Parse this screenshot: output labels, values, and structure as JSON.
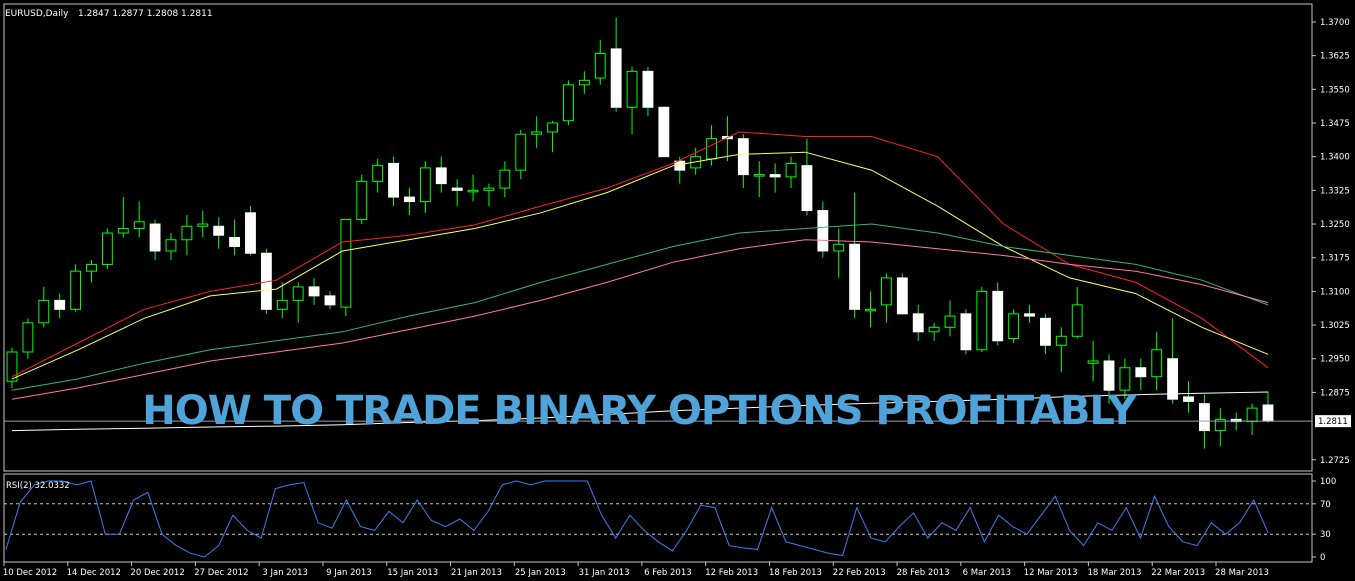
{
  "header": {
    "symbol": "EURUSD,Daily",
    "ohlc": "1.2847 1.2877 1.2808 1.2811"
  },
  "overlay_title": "HOW TO TRADE BINARY OPTIONS PROFITABLY",
  "colors": {
    "background": "#000000",
    "bull_candle": "#000000",
    "bear_candle": "#ffffff",
    "wick": "#00ff00",
    "ma_red": "#ff2020",
    "ma_yellow": "#ffff66",
    "ma_green": "#3cb371",
    "ma_pink": "#ff7a9c",
    "ma_white": "#ffffff",
    "rsi_line": "#3a7ff0",
    "title_blue": "#4fa3d9"
  },
  "chart_data": [
    {
      "type": "candlestick",
      "title": "EURUSD,Daily",
      "ylim": [
        1.27,
        1.374
      ],
      "y_ticks": [
        "1.3700",
        "1.3625",
        "1.3550",
        "1.3475",
        "1.3400",
        "1.3325",
        "1.3250",
        "1.3175",
        "1.3100",
        "1.3025",
        "1.2950",
        "1.2875",
        "1.2725"
      ],
      "current_price": "1.2811",
      "x_tick_labels": [
        "10 Dec 2012",
        "14 Dec 2012",
        "20 Dec 2012",
        "27 Dec 2012",
        "3 Jan 2013",
        "9 Jan 2013",
        "15 Jan 2013",
        "21 Jan 2013",
        "25 Jan 2013",
        "31 Jan 2013",
        "6 Feb 2013",
        "12 Feb 2013",
        "18 Feb 2013",
        "22 Feb 2013",
        "28 Feb 2013",
        "6 Mar 2013",
        "12 Mar 2013",
        "18 Mar 2013",
        "22 Mar 2013",
        "28 Mar 2013"
      ],
      "ohlc": [
        [
          1.29,
          1.2975,
          1.2885,
          1.2965
        ],
        [
          1.2965,
          1.304,
          1.295,
          1.303
        ],
        [
          1.303,
          1.311,
          1.302,
          1.308
        ],
        [
          1.308,
          1.3095,
          1.304,
          1.306
        ],
        [
          1.306,
          1.316,
          1.3055,
          1.3145
        ],
        [
          1.3145,
          1.317,
          1.312,
          1.316
        ],
        [
          1.316,
          1.324,
          1.315,
          1.323
        ],
        [
          1.323,
          1.331,
          1.322,
          1.324
        ],
        [
          1.324,
          1.33,
          1.322,
          1.3255
        ],
        [
          1.325,
          1.326,
          1.317,
          1.319
        ],
        [
          1.319,
          1.323,
          1.317,
          1.3215
        ],
        [
          1.3215,
          1.327,
          1.318,
          1.3245
        ],
        [
          1.3245,
          1.328,
          1.322,
          1.325
        ],
        [
          1.3245,
          1.3265,
          1.3195,
          1.3225
        ],
        [
          1.322,
          1.326,
          1.318,
          1.32
        ],
        [
          1.3275,
          1.329,
          1.318,
          1.3185
        ],
        [
          1.3185,
          1.3195,
          1.305,
          1.306
        ],
        [
          1.306,
          1.312,
          1.304,
          1.308
        ],
        [
          1.308,
          1.312,
          1.303,
          1.311
        ],
        [
          1.311,
          1.313,
          1.307,
          1.309
        ],
        [
          1.309,
          1.31,
          1.306,
          1.307
        ],
        [
          1.3065,
          1.325,
          1.3045,
          1.326
        ],
        [
          1.326,
          1.336,
          1.325,
          1.3345
        ],
        [
          1.3345,
          1.3395,
          1.332,
          1.338
        ],
        [
          1.3385,
          1.34,
          1.329,
          1.331
        ],
        [
          1.331,
          1.333,
          1.327,
          1.33
        ],
        [
          1.33,
          1.339,
          1.3275,
          1.3375
        ],
        [
          1.3375,
          1.34,
          1.332,
          1.334
        ],
        [
          1.333,
          1.335,
          1.329,
          1.3325
        ],
        [
          1.3325,
          1.336,
          1.33,
          1.3325
        ],
        [
          1.3325,
          1.334,
          1.329,
          1.333
        ],
        [
          1.333,
          1.339,
          1.331,
          1.337
        ],
        [
          1.337,
          1.346,
          1.335,
          1.345
        ],
        [
          1.345,
          1.349,
          1.342,
          1.3455
        ],
        [
          1.3455,
          1.348,
          1.341,
          1.3475
        ],
        [
          1.348,
          1.357,
          1.347,
          1.356
        ],
        [
          1.356,
          1.359,
          1.354,
          1.357
        ],
        [
          1.3575,
          1.366,
          1.356,
          1.363
        ],
        [
          1.364,
          1.371,
          1.35,
          1.351
        ],
        [
          1.351,
          1.36,
          1.345,
          1.359
        ],
        [
          1.359,
          1.36,
          1.349,
          1.351
        ],
        [
          1.351,
          1.351,
          1.34,
          1.34
        ],
        [
          1.339,
          1.34,
          1.334,
          1.337
        ],
        [
          1.3375,
          1.342,
          1.336,
          1.34
        ],
        [
          1.3395,
          1.347,
          1.338,
          1.344
        ],
        [
          1.3445,
          1.349,
          1.339,
          1.344
        ],
        [
          1.344,
          1.345,
          1.333,
          1.336
        ],
        [
          1.336,
          1.339,
          1.331,
          1.336
        ],
        [
          1.336,
          1.3385,
          1.332,
          1.3355
        ],
        [
          1.3355,
          1.34,
          1.333,
          1.3385
        ],
        [
          1.338,
          1.344,
          1.327,
          1.328
        ],
        [
          1.328,
          1.33,
          1.3175,
          1.319
        ],
        [
          1.319,
          1.324,
          1.313,
          1.3205
        ],
        [
          1.3205,
          1.332,
          1.304,
          1.306
        ],
        [
          1.306,
          1.31,
          1.302,
          1.306
        ],
        [
          1.307,
          1.314,
          1.303,
          1.313
        ],
        [
          1.313,
          1.314,
          1.305,
          1.305
        ],
        [
          1.305,
          1.307,
          1.299,
          1.301
        ],
        [
          1.301,
          1.303,
          1.299,
          1.302
        ],
        [
          1.302,
          1.308,
          1.3,
          1.3045
        ],
        [
          1.305,
          1.306,
          1.296,
          1.297
        ],
        [
          1.297,
          1.311,
          1.2965,
          1.31
        ],
        [
          1.31,
          1.312,
          1.298,
          1.299
        ],
        [
          1.2995,
          1.306,
          1.2985,
          1.305
        ],
        [
          1.305,
          1.307,
          1.303,
          1.3045
        ],
        [
          1.304,
          1.305,
          1.296,
          1.298
        ],
        [
          1.298,
          1.302,
          1.292,
          1.3
        ],
        [
          1.3,
          1.311,
          1.2995,
          1.307
        ],
        [
          1.294,
          1.299,
          1.29,
          1.2945
        ],
        [
          1.2945,
          1.296,
          1.285,
          1.288
        ],
        [
          1.288,
          1.295,
          1.286,
          1.293
        ],
        [
          1.293,
          1.295,
          1.288,
          1.291
        ],
        [
          1.291,
          1.301,
          1.288,
          1.297
        ],
        [
          1.295,
          1.304,
          1.285,
          1.286
        ],
        [
          1.2865,
          1.29,
          1.283,
          1.2855
        ],
        [
          1.285,
          1.287,
          1.275,
          1.279
        ],
        [
          1.279,
          1.284,
          1.2755,
          1.2815
        ],
        [
          1.2815,
          1.283,
          1.279,
          1.281
        ],
        [
          1.281,
          1.285,
          1.278,
          1.284
        ],
        [
          1.2847,
          1.2877,
          1.2808,
          1.2811
        ]
      ],
      "moving_averages": [
        {
          "color_key": "ma_red",
          "values": [
            1.291,
            1.2985,
            1.306,
            1.31,
            1.3125,
            1.321,
            1.3225,
            1.3248,
            1.329,
            1.333,
            1.3385,
            1.3455,
            1.3445,
            1.3445,
            1.34,
            1.325,
            1.316,
            1.312,
            1.304,
            1.293
          ]
        },
        {
          "color_key": "ma_yellow",
          "values": [
            1.2905,
            1.297,
            1.304,
            1.309,
            1.3105,
            1.319,
            1.3215,
            1.324,
            1.3275,
            1.332,
            1.338,
            1.3405,
            1.341,
            1.337,
            1.329,
            1.32,
            1.313,
            1.3095,
            1.302,
            1.296
          ]
        },
        {
          "color_key": "ma_green",
          "values": [
            1.288,
            1.2905,
            1.294,
            1.297,
            1.299,
            1.301,
            1.3045,
            1.3075,
            1.312,
            1.316,
            1.32,
            1.323,
            1.324,
            1.325,
            1.323,
            1.32,
            1.318,
            1.316,
            1.3125,
            1.307
          ]
        },
        {
          "color_key": "ma_pink",
          "values": [
            1.286,
            1.2885,
            1.2915,
            1.2945,
            1.2965,
            1.2985,
            1.3015,
            1.3045,
            1.308,
            1.312,
            1.3165,
            1.3195,
            1.3215,
            1.321,
            1.3195,
            1.318,
            1.316,
            1.3145,
            1.3115,
            1.3075
          ]
        },
        {
          "color_key": "ma_white",
          "values": [
            1.279,
            1.2793,
            1.2795,
            1.2798,
            1.28,
            1.2803,
            1.2808,
            1.2812,
            1.2818,
            1.2826,
            1.2834,
            1.284,
            1.2846,
            1.2851,
            1.2855,
            1.286,
            1.2866,
            1.287,
            1.2873,
            1.2876
          ]
        }
      ],
      "horizontal_line": 1.2811
    },
    {
      "type": "line",
      "title": "RSI(2) 32.0332",
      "ylim": [
        0,
        100
      ],
      "y_ticks": [
        "100",
        "70",
        "30",
        "0"
      ],
      "levels": [
        70,
        30
      ],
      "values": [
        10,
        72,
        95,
        100,
        100,
        95,
        100,
        30,
        30,
        75,
        85,
        30,
        15,
        5,
        0,
        15,
        55,
        35,
        25,
        90,
        95,
        98,
        45,
        38,
        75,
        40,
        35,
        60,
        45,
        75,
        48,
        40,
        50,
        35,
        60,
        95,
        100,
        95,
        100,
        100,
        100,
        100,
        55,
        25,
        55,
        35,
        20,
        8,
        35,
        68,
        65,
        15,
        12,
        10,
        65,
        20,
        15,
        10,
        5,
        2,
        65,
        25,
        20,
        40,
        58,
        25,
        45,
        35,
        65,
        20,
        55,
        40,
        30,
        55,
        80,
        35,
        15,
        45,
        35,
        65,
        25,
        80,
        40,
        20,
        15,
        45,
        30,
        45,
        75,
        32
      ]
    }
  ]
}
